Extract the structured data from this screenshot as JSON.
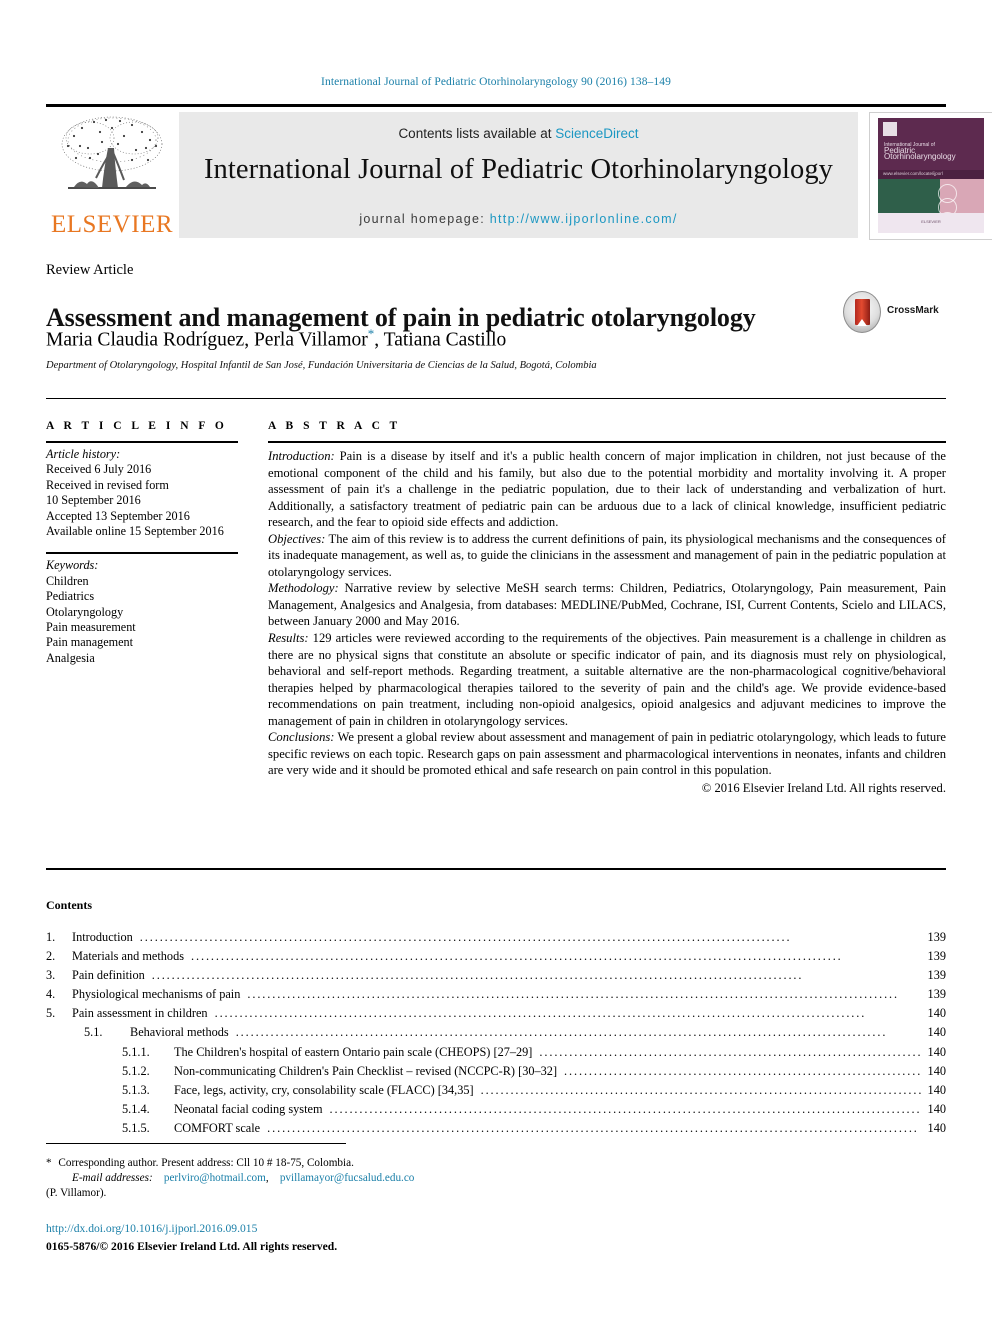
{
  "running_head": "International Journal of Pediatric Otorhinolaryngology 90 (2016) 138–149",
  "masthead": {
    "publisher_name": "ELSEVIER",
    "publisher_logo_icon": "elsevier-tree-logo",
    "contents_available": "Contents lists available at ",
    "sciencedirect_link": "ScienceDirect",
    "journal_title": "International Journal of Pediatric Otorhinolaryngology",
    "homepage_label": "journal homepage:",
    "homepage_url": "http://www.ijporlonline.com/",
    "cover": {
      "publisher_mark": "elsevier-mark-icon",
      "small_line": "International Journal of",
      "title": "Pediatric Otorhinolaryngology",
      "band_text": "www.elsevier.com/locate/ijporl",
      "footer_text": "ELSEVIER"
    },
    "colors": {
      "link_blue": "#1b97c2",
      "elsevier_orange": "#e87722",
      "banner_grey": "#e9e9e9",
      "cover_purple": "#5d2a4f"
    }
  },
  "article": {
    "kicker": "Review Article",
    "title": "Assessment and management of pain in pediatric otolaryngology",
    "authors": "Maria Claudia Rodríguez, Perla Villamor",
    "authors_tail": ", Tatiana Castillo",
    "corresponding_marker": "*",
    "affiliation": "Department of Otolaryngology, Hospital Infantil de San José, Fundación Universitaria de Ciencias de la Salud, Bogotá, Colombia",
    "crossmark_label": "CrossMark"
  },
  "article_info": {
    "heading": "A R T I C L E   I N F O",
    "history_label": "Article history:",
    "history": [
      "Received 6 July 2016",
      "Received in revised form",
      "10 September 2016",
      "Accepted 13 September 2016",
      "Available online 15 September 2016"
    ],
    "keywords_label": "Keywords:",
    "keywords": [
      "Children",
      "Pediatrics",
      "Otolaryngology",
      "Pain measurement",
      "Pain management",
      "Analgesia"
    ]
  },
  "abstract": {
    "heading": "A B S T R A C T",
    "sections": [
      {
        "label": "Introduction:",
        "text": " Pain is a disease by itself and it's a public health concern of major implication in children, not just because of the emotional component of the child and his family, but also due to the potential morbidity and mortality involving it. A proper assessment of pain it's a challenge in the pediatric population, due to their lack of understanding and verbalization of hurt. Additionally, a satisfactory treatment of pediatric pain can be arduous due to a lack of clinical knowledge, insufficient pediatric research, and the fear to opioid side effects and addiction."
      },
      {
        "label": "Objectives:",
        "text": " The aim of this review is to address the current definitions of pain, its physiological mechanisms and the consequences of its inadequate management, as well as, to guide the clinicians in the assessment and management of pain in the pediatric population at otolaryngology services."
      },
      {
        "label": "Methodology:",
        "text": " Narrative review by selective MeSH search terms: Children, Pediatrics, Otolaryngology, Pain measurement, Pain Management, Analgesics and Analgesia, from databases: MEDLINE/PubMed, Cochrane, ISI, Current Contents, Scielo and LILACS, between January 2000 and May 2016."
      },
      {
        "label": "Results:",
        "text": " 129 articles were reviewed according to the requirements of the objectives. Pain measurement is a challenge in children as there are no physical signs that constitute an absolute or specific indicator of pain, and its diagnosis must rely on physiological, behavioral and self-report methods. Regarding treatment, a suitable alternative are the non-pharmacological cognitive/behavioral therapies helped by pharmacological therapies tailored to the severity of pain and the child's age. We provide evidence-based recommendations on pain treatment, including non-opioid analgesics, opioid analgesics and adjuvant medicines to improve the management of pain in children in otolaryngology services."
      },
      {
        "label": "Conclusions:",
        "text": " We present a global review about assessment and management of pain in pediatric otolaryngology, which leads to future specific reviews on each topic. Research gaps on pain assessment and pharmacological interventions in neonates, infants and children are very wide and it should be promoted ethical and safe research on pain control in this population."
      }
    ],
    "copyright": "© 2016 Elsevier Ireland Ltd. All rights reserved."
  },
  "contents": {
    "heading": "Contents",
    "items": [
      {
        "num": "1.",
        "label": "Introduction",
        "page": "139",
        "level": 1
      },
      {
        "num": "2.",
        "label": "Materials and methods",
        "page": "139",
        "level": 1
      },
      {
        "num": "3.",
        "label": "Pain definition",
        "page": "139",
        "level": 1
      },
      {
        "num": "4.",
        "label": "Physiological mechanisms of pain",
        "page": "139",
        "level": 1
      },
      {
        "num": "5.",
        "label": "Pain assessment in children",
        "page": "140",
        "level": 1
      },
      {
        "num": "5.1.",
        "label": "Behavioral methods",
        "page": "140",
        "level": 2
      },
      {
        "num": "5.1.1.",
        "label": "The Children's hospital of eastern Ontario pain scale (CHEOPS) [27–29]",
        "page": "140",
        "level": 3
      },
      {
        "num": "5.1.2.",
        "label": "Non-communicating Children's Pain Checklist – revised (NCCPC-R) [30–32]",
        "page": "140",
        "level": 3
      },
      {
        "num": "5.1.3.",
        "label": "Face, legs, activity, cry, consolability scale (FLACC) [34,35]",
        "page": "140",
        "level": 3
      },
      {
        "num": "5.1.4.",
        "label": "Neonatal facial coding system",
        "page": "140",
        "level": 3
      },
      {
        "num": "5.1.5.",
        "label": "COMFORT scale",
        "page": "140",
        "level": 3
      }
    ]
  },
  "footnotes": {
    "corresponding": "Corresponding author. Present address: Cll 10 # 18-75, Colombia.",
    "email_label": "E-mail addresses:",
    "email1": "perlviro@hotmail.com",
    "email_sep": ",",
    "email2": "pvillamayor@fucsalud.edu.co",
    "email_owner": "(P. Villamor).",
    "doi": "http://dx.doi.org/10.1016/j.ijporl.2016.09.015",
    "issn_line": "0165-5876/© 2016 Elsevier Ireland Ltd. All rights reserved."
  }
}
